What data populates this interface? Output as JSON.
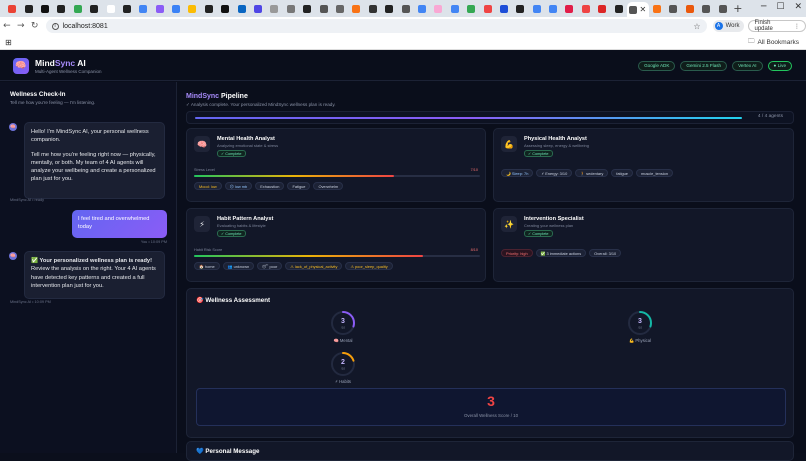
{
  "browser": {
    "tabs": [
      {
        "icon": "gmail-icon",
        "color": "#ea4335"
      },
      {
        "icon": "github-icon",
        "color": "#222222"
      },
      {
        "icon": "notion-icon",
        "color": "#111111"
      },
      {
        "icon": "github-icon",
        "color": "#222222"
      },
      {
        "icon": "spreadsheet-icon",
        "color": "#34a853"
      },
      {
        "icon": "github-icon",
        "color": "#222222"
      },
      {
        "icon": "doc-icon",
        "color": "#ffffff"
      },
      {
        "icon": "github-icon",
        "color": "#222222"
      },
      {
        "icon": "sparkle-icon",
        "color": "#4285f4"
      },
      {
        "icon": "linear-icon",
        "color": "#8b5cf6"
      },
      {
        "icon": "k-icon",
        "color": "#3b82f6"
      },
      {
        "icon": "drive-icon",
        "color": "#fbbc04"
      },
      {
        "icon": "github-icon",
        "color": "#222222"
      },
      {
        "icon": "x-icon",
        "color": "#111111"
      },
      {
        "icon": "linkedin-icon",
        "color": "#0a66c2"
      },
      {
        "icon": "arc-icon",
        "color": "#4f46e5"
      },
      {
        "icon": "dash-icon",
        "color": "#999999"
      },
      {
        "icon": "vr-icon",
        "color": "#777777"
      },
      {
        "icon": "github-icon",
        "color": "#222222"
      },
      {
        "icon": "globe-icon",
        "color": "#555555"
      },
      {
        "icon": "video-icon",
        "color": "#666666"
      },
      {
        "icon": "flame-icon",
        "color": "#f97316"
      },
      {
        "icon": "a-icon",
        "color": "#333333"
      },
      {
        "icon": "github-icon",
        "color": "#222222"
      },
      {
        "icon": "globe-icon",
        "color": "#555555"
      },
      {
        "icon": "google-icon",
        "color": "#4285f4"
      },
      {
        "icon": "circle-icon",
        "color": "#f9a8d4"
      },
      {
        "icon": "google-icon",
        "color": "#4285f4"
      },
      {
        "icon": "drive-icon",
        "color": "#34a853"
      },
      {
        "icon": "pdf-icon",
        "color": "#ef4444"
      },
      {
        "icon": "info-icon",
        "color": "#1d4ed8"
      },
      {
        "icon": "github-icon",
        "color": "#222222"
      },
      {
        "icon": "google-icon",
        "color": "#4285f4"
      },
      {
        "icon": "google-icon",
        "color": "#4285f4"
      },
      {
        "icon": "bookmark-icon",
        "color": "#e11d48"
      },
      {
        "icon": "youtube-icon",
        "color": "#ef4444"
      },
      {
        "icon": "c-icon",
        "color": "#dc2626"
      },
      {
        "icon": "perplexity-icon",
        "color": "#222222"
      },
      {
        "icon": "globe-icon",
        "color": "#555555",
        "active": true
      },
      {
        "icon": "flame-icon",
        "color": "#f97316"
      },
      {
        "icon": "globe-icon",
        "color": "#555555"
      },
      {
        "icon": "ship-icon",
        "color": "#ea580c"
      },
      {
        "icon": "globe-icon",
        "color": "#555555"
      },
      {
        "icon": "globe-icon",
        "color": "#555555"
      }
    ],
    "url": "localhost:8081",
    "profile_label": "Work",
    "profile_initial": "A",
    "finish_update": "Finish update",
    "all_bookmarks": "All Bookmarks"
  },
  "app": {
    "brand_prefix": "Mind",
    "brand_accent": "Sync",
    "brand_suffix": " AI",
    "brand_sub": "Multi-Agent Wellness Companion",
    "pills": [
      "Google ADK",
      "Gemini 2.5 Flash",
      "Vertex AI",
      "● Live"
    ]
  },
  "sidebar": {
    "title": "Wellness Check-In",
    "subtitle": "Tell me how you're feeling — I'm listening.",
    "messages": [
      {
        "p1": "Hello! I'm MindSync AI, your personal wellness companion.",
        "p2": "Tell me how you're feeling right now — physically, mentally, or both. My team of 4 AI agents will analyze your wellbeing and create a personalized plan just for you.",
        "meta": "MindSync AI • ready"
      },
      {
        "text": "I feel tired and overwhelmed today",
        "meta": "You • 10:09 PM"
      },
      {
        "p1": "✅ Your personalized wellness plan is ready!",
        "p2": "Review the analysis on the right. Your 4 AI agents have detected key patterns and created a full intervention plan just for you.",
        "meta": "MindSync AI • 10:09 PM"
      }
    ]
  },
  "pipeline": {
    "title_accent": "MindSync",
    "title_rest": " Pipeline",
    "subtitle": "✓ Analysis complete. Your personalized MindSync wellness plan is ready.",
    "progress": 1.0,
    "progress_text": "4 / 4 agents"
  },
  "agents": {
    "mental": {
      "title": "Mental Health Analyst",
      "sub": "Analyzing emotional state & stress",
      "badge": "✓ Complete",
      "level_label": "Stress Level",
      "level_value": "7/10",
      "level": 0.7,
      "tags": [
        "Mood: low",
        "☹ low mb",
        "Exhaustion",
        "Fatigue",
        "Overwhelm"
      ]
    },
    "physical": {
      "title": "Physical Health Analyst",
      "sub": "Assessing sleep, energy & wellbeing",
      "badge": "✓ Complete",
      "tags": [
        "🌙 Sleep: 7h",
        "⚡ Energy: 3/10",
        "🚶 sedentary",
        "fatigue",
        "muscle_tension"
      ]
    },
    "habit": {
      "title": "Habit Pattern Analyst",
      "sub": "Evaluating habits & lifestyle",
      "badge": "✓ Complete",
      "level_label": "Habit Risk Score",
      "level_value": "8/10",
      "level": 0.8,
      "tags": [
        "🏠 home",
        "👥 unknown",
        "😴 poor",
        "⚠ lack_of_physical_activity",
        "⚠ poor_sleep_quality"
      ]
    },
    "intervention": {
      "title": "Intervention Specialist",
      "sub": "Creating your wellness plan",
      "badge": "✓ Complete",
      "tags": [
        "Priority: high",
        "✅ 3 immediate actions",
        "Overall: 3/10"
      ]
    }
  },
  "assessment": {
    "title": "🎯 Wellness Assessment",
    "gauges": [
      {
        "label": "🧠 Mental",
        "value": "3",
        "of": "/10",
        "score": 0.3,
        "color": "#8b5cf6"
      },
      {
        "label": "💪 Physical",
        "value": "3",
        "of": "/10",
        "score": 0.3,
        "color": "#14b8a6"
      },
      {
        "label": "⚡ Habits",
        "value": "2",
        "of": "/10",
        "score": 0.2,
        "color": "#f59e0b"
      }
    ],
    "overall_value": "3",
    "overall_label": "Overall Wellness Score / 10"
  },
  "personal_message": {
    "title": "💙 Personal Message"
  }
}
